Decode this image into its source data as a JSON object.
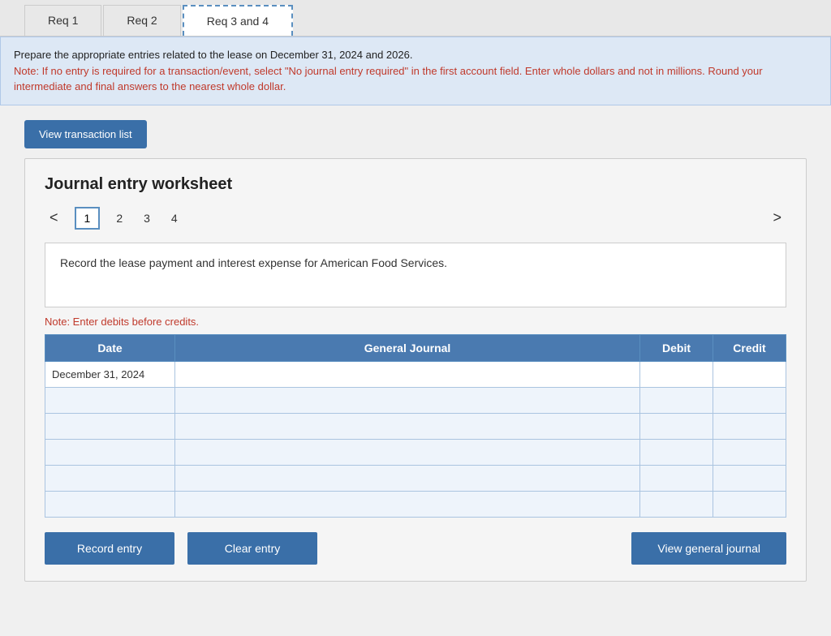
{
  "tabs": [
    {
      "label": "Req 1",
      "active": false
    },
    {
      "label": "Req 2",
      "active": false
    },
    {
      "label": "Req 3 and 4",
      "active": true
    }
  ],
  "info_box": {
    "main_text": "Prepare the appropriate entries related to the lease on December 31, 2024 and 2026.",
    "note_text": "Note: If no entry is required for a transaction/event, select \"No journal entry required\" in the first account field. Enter whole dollars and not in millions. Round your intermediate and final answers to the nearest whole dollar."
  },
  "view_transaction_btn": "View transaction list",
  "worksheet": {
    "title": "Journal entry worksheet",
    "pages": [
      "1",
      "2",
      "3",
      "4"
    ],
    "active_page": "1",
    "nav_left": "<",
    "nav_right": ">",
    "description": "Record the lease payment and interest expense for American Food Services.",
    "note": "Note: Enter debits before credits.",
    "table": {
      "headers": [
        "Date",
        "General Journal",
        "Debit",
        "Credit"
      ],
      "rows": [
        {
          "date": "December 31, 2024",
          "gj": "",
          "debit": "",
          "credit": ""
        },
        {
          "date": "",
          "gj": "",
          "debit": "",
          "credit": ""
        },
        {
          "date": "",
          "gj": "",
          "debit": "",
          "credit": ""
        },
        {
          "date": "",
          "gj": "",
          "debit": "",
          "credit": ""
        },
        {
          "date": "",
          "gj": "",
          "debit": "",
          "credit": ""
        },
        {
          "date": "",
          "gj": "",
          "debit": "",
          "credit": ""
        }
      ]
    }
  },
  "buttons": {
    "record_entry": "Record entry",
    "clear_entry": "Clear entry",
    "view_general_journal": "View general journal"
  }
}
